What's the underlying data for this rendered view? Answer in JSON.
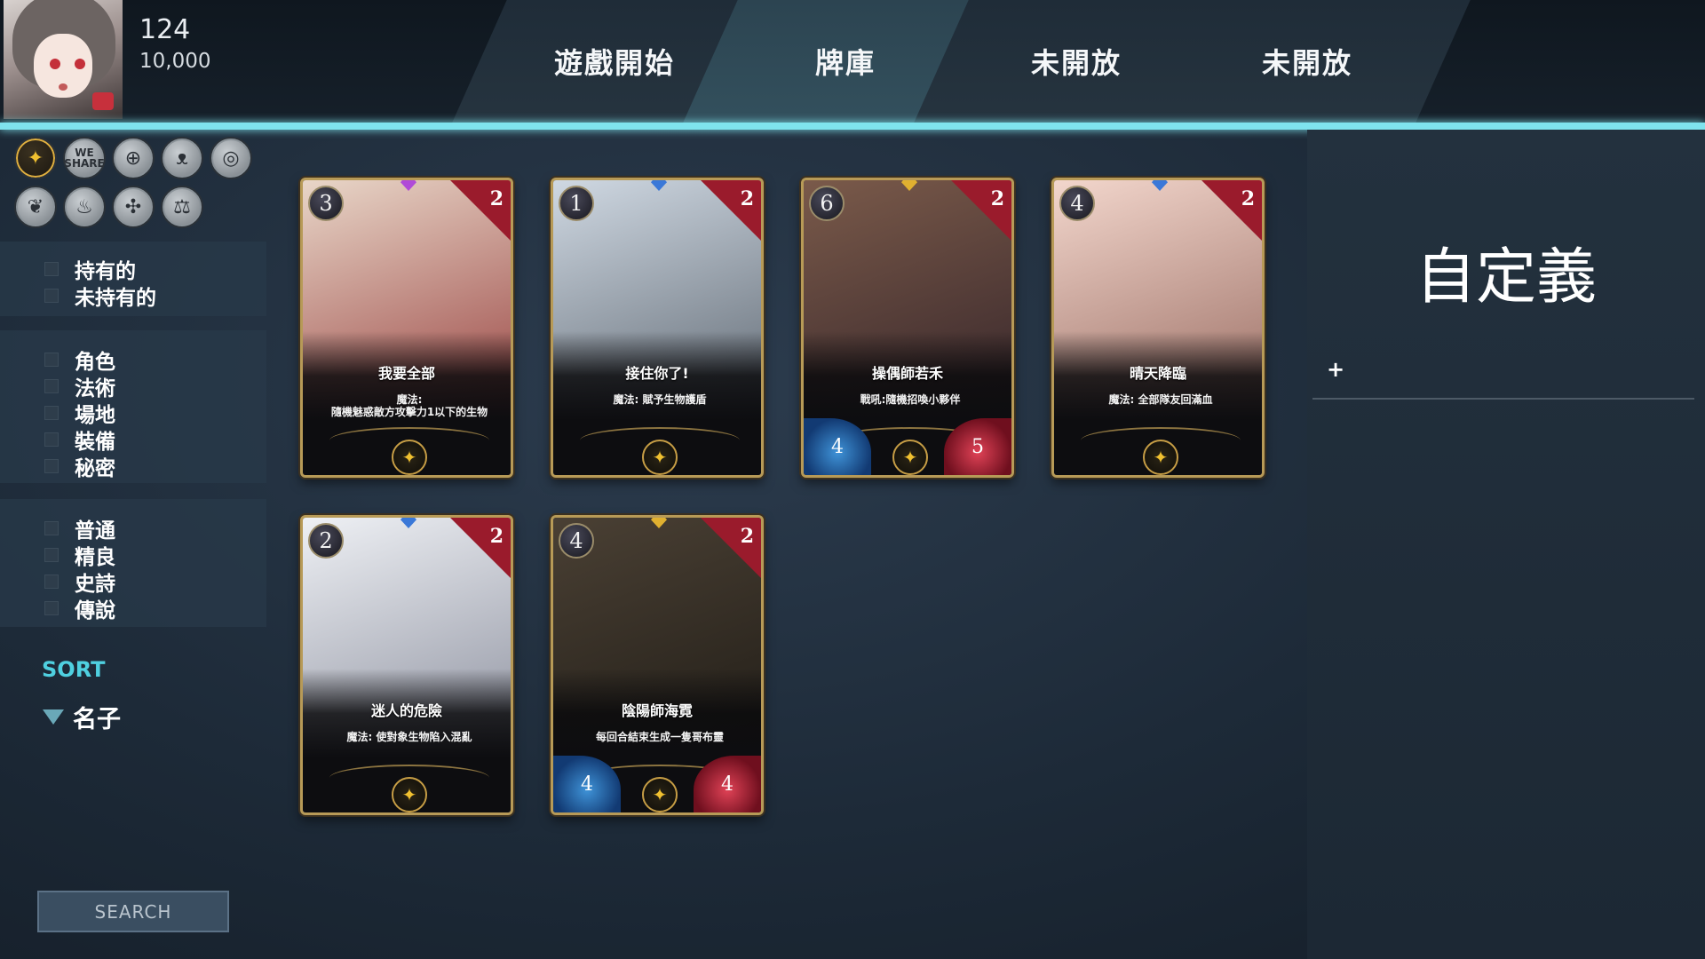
{
  "player": {
    "level": "124",
    "gold": "10,000"
  },
  "tabs": [
    {
      "label": "遊戲開始"
    },
    {
      "label": "牌庫"
    },
    {
      "label": "未開放"
    },
    {
      "label": "未開放"
    }
  ],
  "filters": {
    "factions": [
      {
        "icon": "butterfly-icon",
        "active": true
      },
      {
        "icon": "text-logo-icon",
        "text": "WE\nSHARE"
      },
      {
        "icon": "rune-crest-icon"
      },
      {
        "icon": "cat-face-icon"
      },
      {
        "icon": "swirl-icon"
      },
      {
        "icon": "leaf-swirl-icon"
      },
      {
        "icon": "flame-icon"
      },
      {
        "icon": "glyph-crest-icon"
      },
      {
        "icon": "scales-icon"
      }
    ],
    "ownership": [
      "持有的",
      "未持有的"
    ],
    "types": [
      "角色",
      "法術",
      "場地",
      "裝備",
      "秘密"
    ],
    "rarities": [
      "普通",
      "精良",
      "史詩",
      "傳說"
    ]
  },
  "sort": {
    "title": "SORT",
    "option": "名子"
  },
  "search": {
    "label": "SEARCH"
  },
  "cards": [
    {
      "cost": "3",
      "count": "2",
      "name": "我要全部",
      "desc_line1": "魔法:",
      "desc_line2": "隨機魅惑敵方攻擊力1以下的生物",
      "gem": "#b04ad8",
      "art_from": "#e8d6c8",
      "art_to": "#8c2a2a"
    },
    {
      "cost": "1",
      "count": "2",
      "name": "接住你了!",
      "desc_line1": "魔法: 賦予生物護盾",
      "desc_line2": "",
      "gem": "#3a78d8",
      "art_from": "#cfd8e2",
      "art_to": "#4d5660"
    },
    {
      "cost": "6",
      "count": "2",
      "name": "操偶師若禾",
      "desc_line1": "戰吼:隨機招喚小夥伴",
      "desc_line2": "",
      "gem": "#e0b030",
      "art_from": "#7a5a4a",
      "art_to": "#2a1c24",
      "attack": "4",
      "health": "5"
    },
    {
      "cost": "4",
      "count": "2",
      "name": "晴天降臨",
      "desc_line1": "魔法: 全部隊友回滿血",
      "desc_line2": "",
      "gem": "#3a78d8",
      "art_from": "#f2d6cc",
      "art_to": "#8a5a50"
    },
    {
      "cost": "2",
      "count": "2",
      "name": "迷人的危險",
      "desc_line1": "魔法: 使對象生物陷入混亂",
      "desc_line2": "",
      "gem": "#3a78d8",
      "art_from": "#eef0f4",
      "art_to": "#7c8090"
    },
    {
      "cost": "4",
      "count": "2",
      "name": "陰陽師海霓",
      "desc_line1": "每回合結束生成一隻哥布靈",
      "desc_line2": "",
      "gem": "#e0b030",
      "art_from": "#4a4034",
      "art_to": "#1a1712",
      "attack": "4",
      "health": "4"
    }
  ],
  "deck_panel": {
    "title": "自定義",
    "add_label": "+"
  },
  "colors": {
    "accent": "#7fe3ee",
    "sort_title": "#4fd0e0",
    "card_corner": "#9a1b2c",
    "card_border": "#b79a57"
  }
}
